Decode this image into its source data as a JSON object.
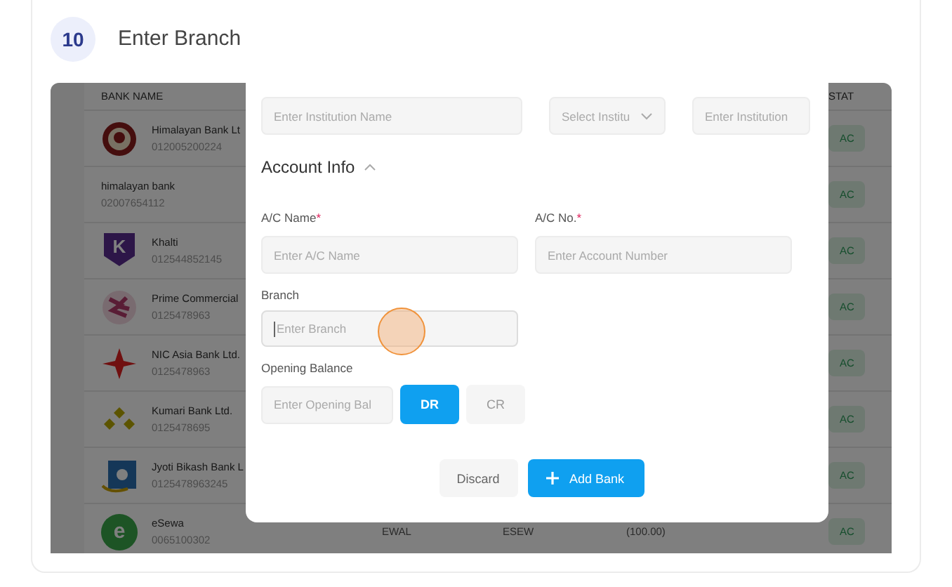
{
  "step": {
    "number": "10",
    "title": "Enter Branch"
  },
  "table": {
    "columns": [
      "BANK NAME",
      "STAT"
    ],
    "rows": [
      {
        "kind": "seal",
        "name": "Himalayan Bank Lt",
        "number": "012005200224",
        "status": "AC"
      },
      {
        "kind": "plain",
        "name": "himalayan bank",
        "number": "02007654112",
        "status": "AC"
      },
      {
        "kind": "shield",
        "logo_text": "K",
        "name": "Khalti",
        "number": "012544852145",
        "status": "AC"
      },
      {
        "kind": "pattern",
        "name": "Prime Commercial",
        "number": "0125478963",
        "status": "AC"
      },
      {
        "kind": "star",
        "name": "NIC Asia Bank Ltd.",
        "number": "0125478963",
        "status": "AC"
      },
      {
        "kind": "diamonds",
        "name": "Kumari Bank Ltd.",
        "number": "0125478695",
        "status": "AC"
      },
      {
        "kind": "square",
        "name": "Jyoti Bikash Bank L",
        "number": "0125478963245",
        "status": "AC"
      },
      {
        "kind": "circle",
        "logo_text": "e",
        "name": "eSewa",
        "number": "0065100302",
        "cells": [
          "EWAL",
          "ESEW",
          "(100.00)"
        ],
        "status": "AC"
      }
    ]
  },
  "modal": {
    "institution": {
      "name_placeholder": "Enter Institution Name",
      "type_placeholder": "Select Institu",
      "code_placeholder": "Enter Institution"
    },
    "section": {
      "title": "Account Info",
      "expanded": true
    },
    "ac_name": {
      "label": "A/C Name",
      "required_mark": "*",
      "placeholder": "Enter A/C Name"
    },
    "ac_no": {
      "label": "A/C No.",
      "required_mark": "*",
      "placeholder": "Enter Account Number"
    },
    "branch": {
      "label": "Branch",
      "placeholder": "Enter Branch",
      "focused": true
    },
    "opening": {
      "label": "Opening Balance",
      "placeholder": "Enter Opening Bal"
    },
    "toggles": [
      {
        "label": "DR",
        "selected": true
      },
      {
        "label": "CR",
        "selected": false
      }
    ],
    "discard": "Discard",
    "submit": "Add Bank"
  }
}
